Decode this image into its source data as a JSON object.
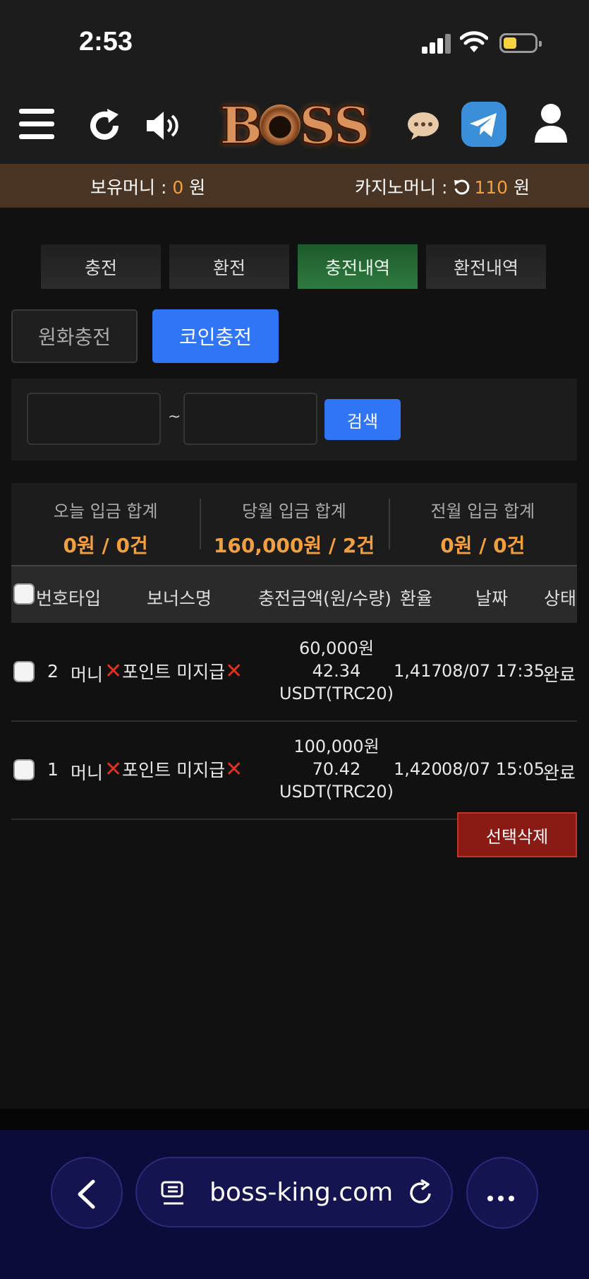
{
  "status": {
    "time": "2:53"
  },
  "money": {
    "holding_label": "보유머니 : ",
    "holding_value": "0",
    "holding_unit": " 원",
    "casino_label": "카지노머니 : ",
    "casino_value": "110",
    "casino_unit": " 원"
  },
  "tabs": [
    {
      "label": "충전"
    },
    {
      "label": "환전"
    },
    {
      "label": "충전내역",
      "active": true
    },
    {
      "label": "환전내역"
    }
  ],
  "charge_type": {
    "won": "원화충전",
    "coin": "코인충전"
  },
  "search": {
    "from": "",
    "to": "",
    "separator": "~",
    "button": "검색"
  },
  "summary": [
    {
      "label": "오늘 입금 합계",
      "value": "0원 / 0건"
    },
    {
      "label": "당월 입금 합계",
      "value": "160,000원 / 2건"
    },
    {
      "label": "전월 입금 합계",
      "value": "0원 / 0건"
    }
  ],
  "table": {
    "headers": {
      "no_type": "번호타입",
      "bonus": "보너스명",
      "amount": "충전금액(원/수량)",
      "rate": "환율",
      "date": "날짜",
      "status": "상태"
    },
    "rows": [
      {
        "no": "2",
        "type": "머니",
        "bonus": "포인트 미지급",
        "won": "60,000원",
        "qty": "42.34",
        "coin": "USDT(TRC20)",
        "rate": "1,417",
        "date": "08/07 17:35",
        "status": "완료"
      },
      {
        "no": "1",
        "type": "머니",
        "bonus": "포인트 미지급",
        "won": "100,000원",
        "qty": "70.42",
        "coin": "USDT(TRC20)",
        "rate": "1,420",
        "date": "08/07 15:05",
        "status": "완료"
      }
    ]
  },
  "delete_button": "선택삭제",
  "browser": {
    "url": "boss-king.com"
  },
  "colors": {
    "accent_blue": "#2f75f5",
    "orange": "#f0a040",
    "active_tab": "#2f7a40",
    "delete_red": "#8a1a14"
  }
}
